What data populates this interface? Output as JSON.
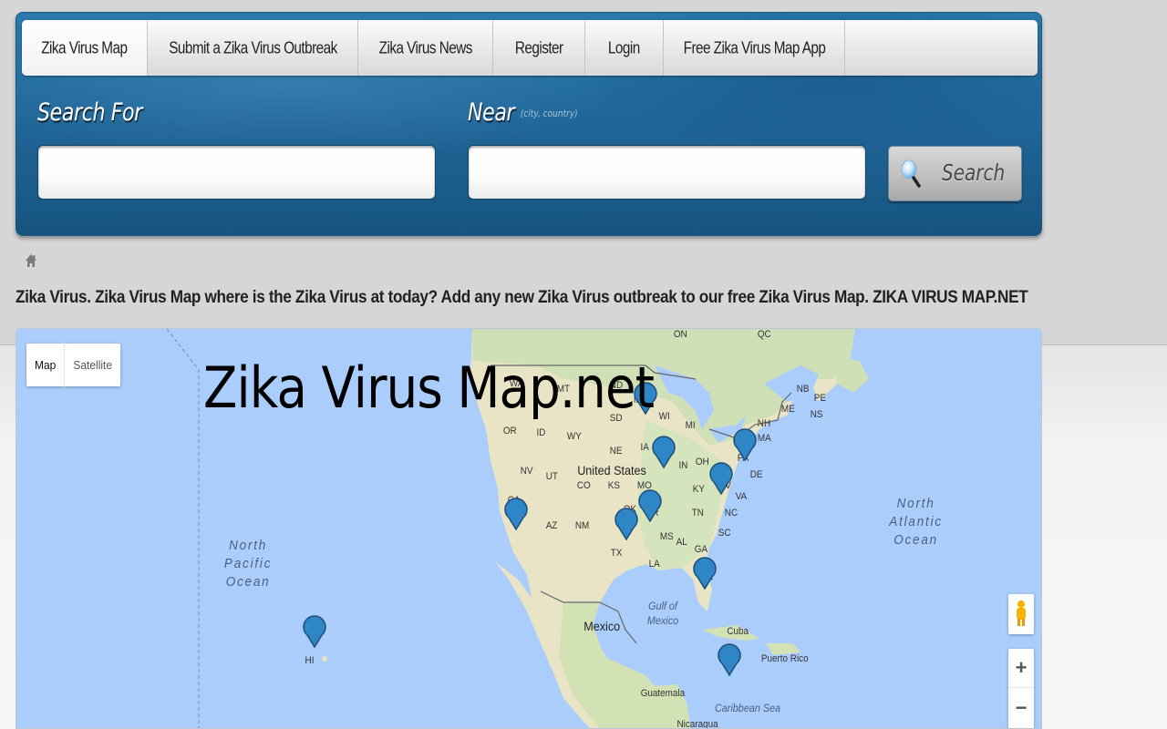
{
  "nav": {
    "items": [
      {
        "label": "Zika Virus Map",
        "active": true
      },
      {
        "label": "Submit a Zika Virus Outbreak",
        "active": false
      },
      {
        "label": "Zika Virus News",
        "active": false
      },
      {
        "label": "Register",
        "active": false
      },
      {
        "label": "Login",
        "active": false
      },
      {
        "label": "Free Zika Virus Map App",
        "active": false
      }
    ]
  },
  "search": {
    "search_for_label": "Search For",
    "search_for_value": "",
    "near_label": "Near",
    "near_hint": "(city, country)",
    "near_value": "",
    "button_label": "Search"
  },
  "breadcrumb": {
    "home_icon": "home-icon"
  },
  "intro": {
    "text": "Zika Virus. Zika Virus Map where is the Zika Virus at today? Add any new Zika Virus outbreak to our free Zika Virus Map. ZIKA VIRUS MAP.NET"
  },
  "map": {
    "type_controls": {
      "map": "Map",
      "satellite": "Satellite",
      "selected": "Map"
    },
    "overlay_title": "Zika Virus Map.net",
    "zoom_in": "+",
    "zoom_out": "−",
    "marker_color": "#2f86c6",
    "labels": {
      "countries": [
        "United States",
        "Mexico",
        "Cuba",
        "Puerto Rico",
        "Guatemala",
        "Nicaragua"
      ],
      "oceans": [
        "North\nPacific\nOcean",
        "North\nAtlantic\nOcean"
      ],
      "seas": [
        "Gulf of\nMexico",
        "Caribbean Sea"
      ],
      "regions": [
        "ON",
        "QC",
        "NB",
        "PE",
        "NS",
        "ME",
        "NH",
        "MA",
        "WA",
        "MT",
        "ND",
        "SD",
        "MN",
        "WI",
        "MI",
        "OR",
        "ID",
        "WY",
        "NE",
        "IA",
        "IN",
        "OH",
        "PA",
        "DE",
        "NV",
        "UT",
        "CO",
        "KS",
        "MO",
        "KY",
        "WV",
        "VA",
        "CA",
        "AZ",
        "NM",
        "TX",
        "OK",
        "AR",
        "TN",
        "NC",
        "SC",
        "MS",
        "AL",
        "GA",
        "LA",
        "FL",
        "HI"
      ]
    },
    "markers": [
      {
        "location": "MN"
      },
      {
        "location": "IA"
      },
      {
        "location": "MA"
      },
      {
        "location": "VA"
      },
      {
        "location": "MO"
      },
      {
        "location": "TX"
      },
      {
        "location": "CA"
      },
      {
        "location": "FL"
      },
      {
        "location": "Caribbean"
      },
      {
        "location": "HI"
      }
    ]
  }
}
